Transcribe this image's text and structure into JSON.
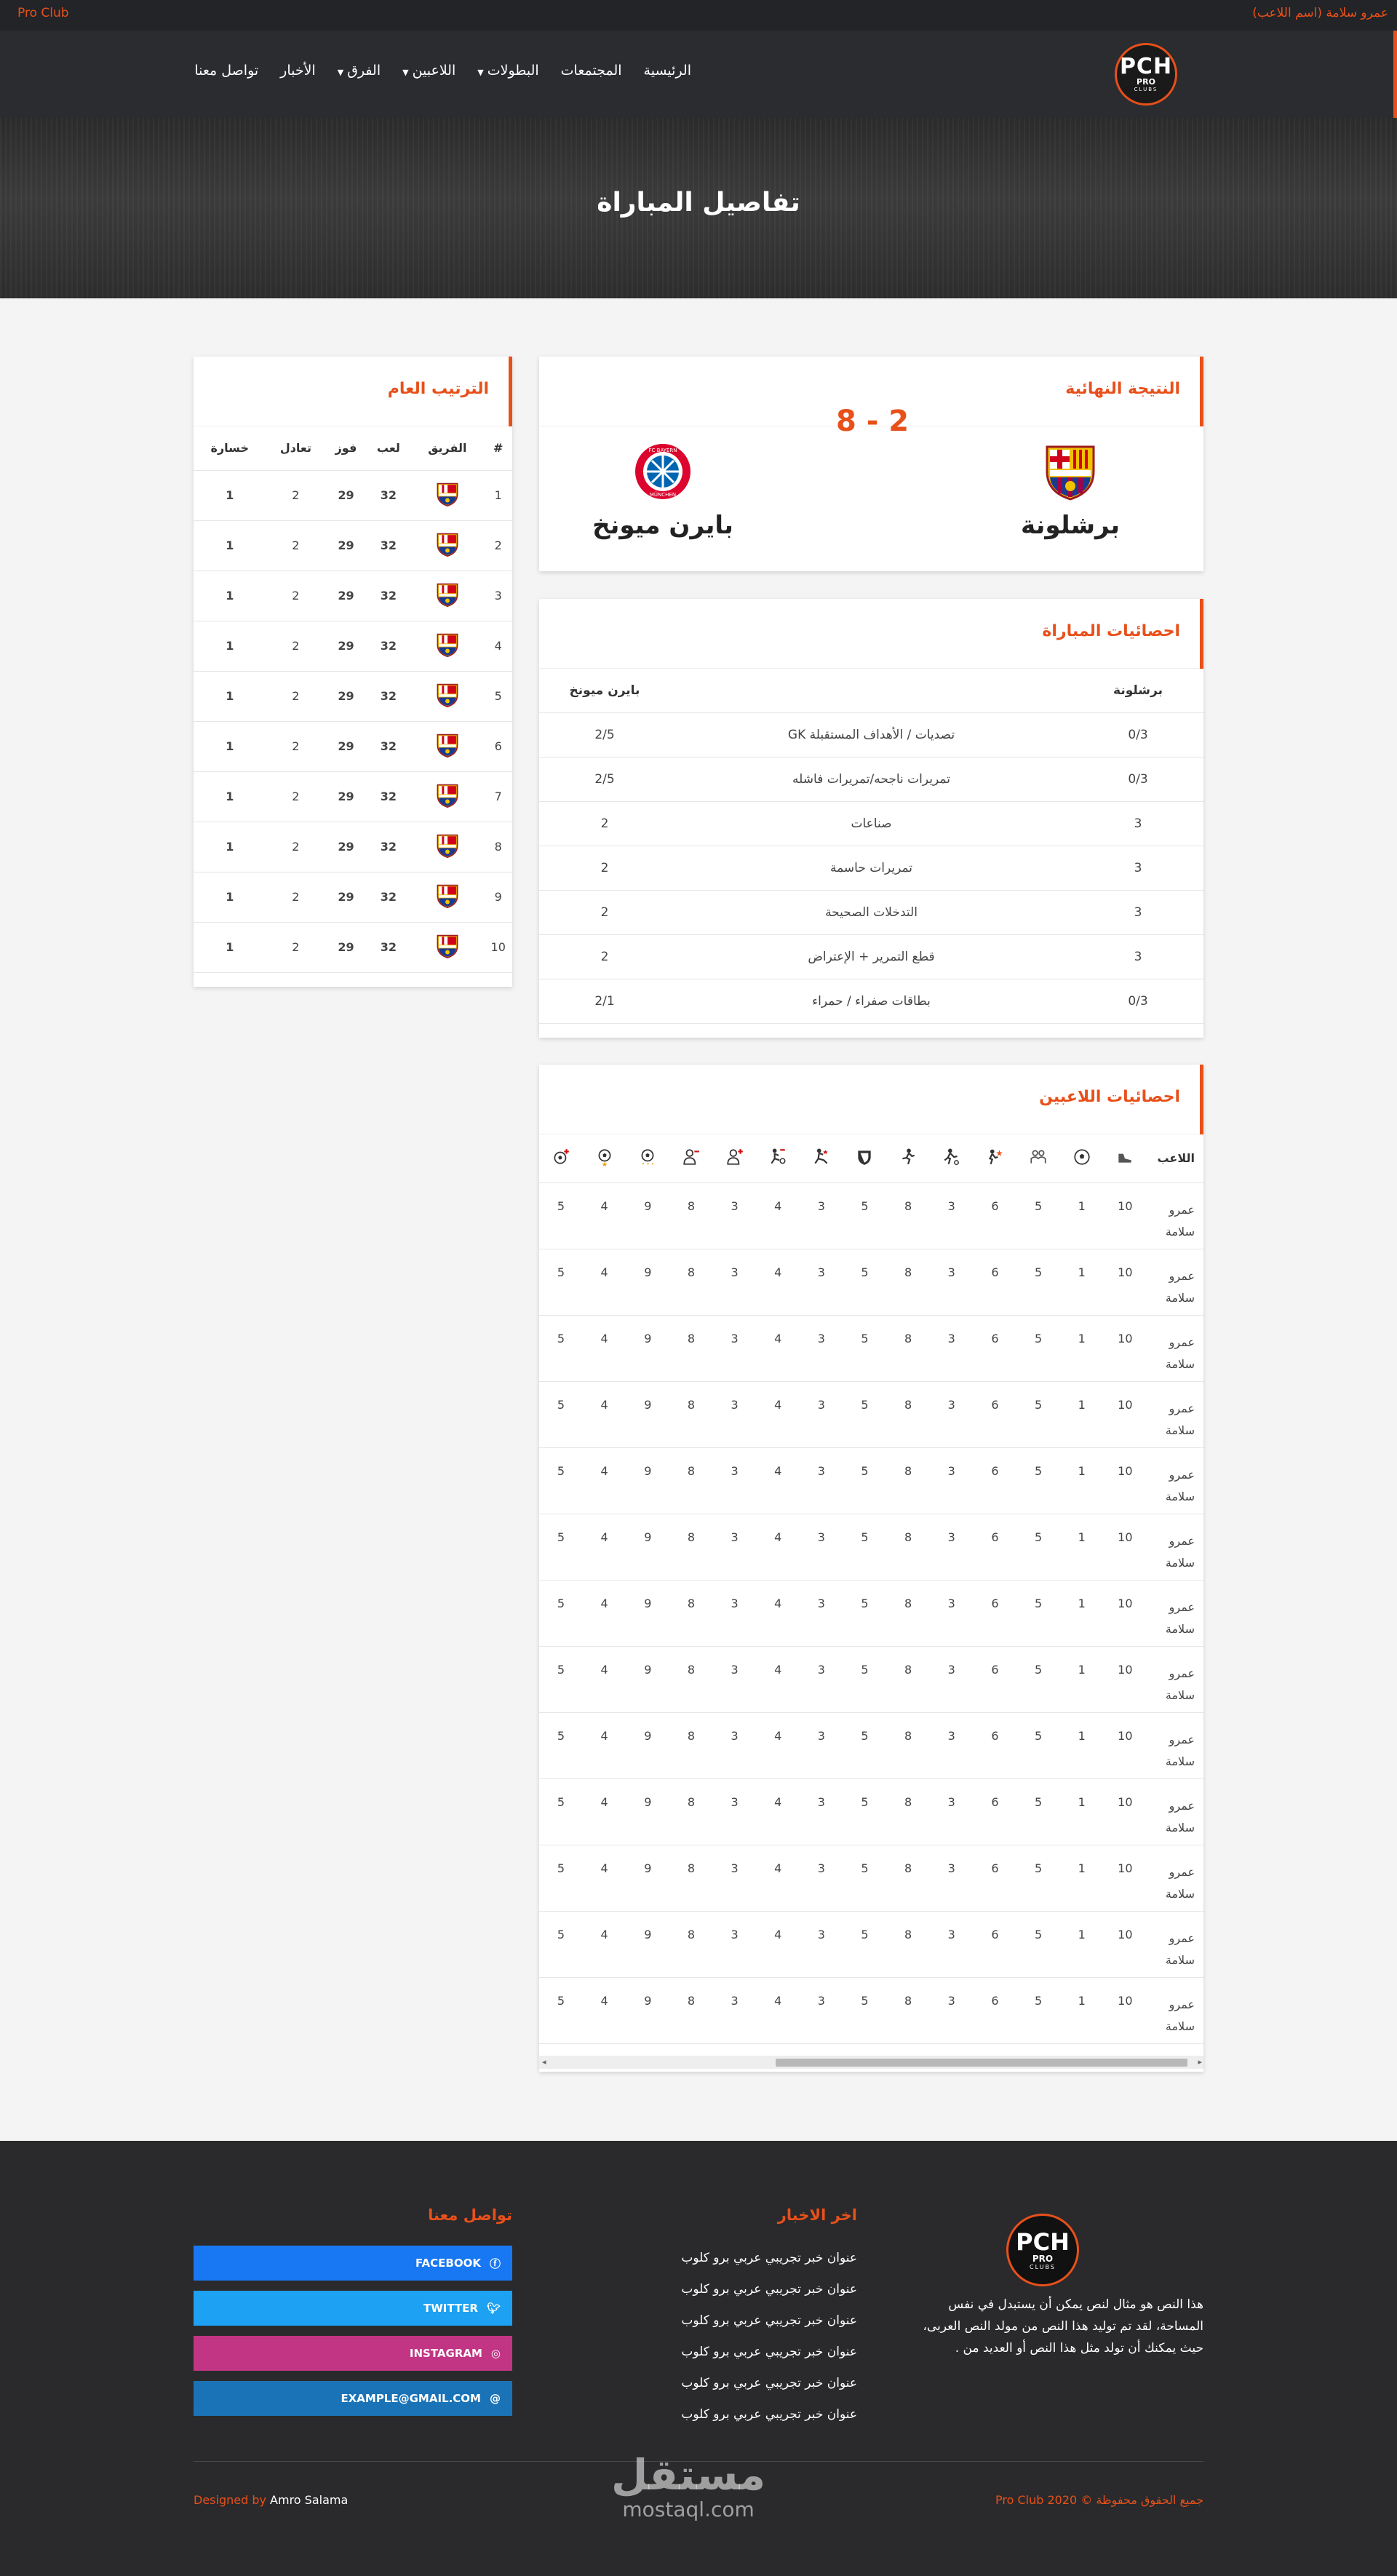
{
  "topbar": {
    "brand": "Pro Club",
    "user": "عمرو سلامة (اسم اللاعب)"
  },
  "logo": {
    "line1": "PCH",
    "line2": "PRO",
    "line3": "CLUBS"
  },
  "nav": [
    {
      "label": "الرئيسية",
      "dropdown": false
    },
    {
      "label": "المجتمعات",
      "dropdown": false
    },
    {
      "label": "البطولات",
      "dropdown": true
    },
    {
      "label": "اللاعبين",
      "dropdown": true
    },
    {
      "label": "الفرق",
      "dropdown": true
    },
    {
      "label": "الأخبار",
      "dropdown": false
    },
    {
      "label": "تواصل معنا",
      "dropdown": false
    }
  ],
  "hero": {
    "title": "تفاصيل المباراة"
  },
  "final": {
    "title": "النتيجة النهائية",
    "home": "برشلونة",
    "away": "بايرن ميونخ",
    "score": "8 - 2"
  },
  "stats": {
    "title": "احصائيات المباراة",
    "home": "برشلونة",
    "away": "بايرن ميونخ",
    "rows": [
      {
        "home": "0/3",
        "label": "GK تصديات / الأهداف المستقبلة",
        "away": "2/5"
      },
      {
        "home": "0/3",
        "label": "تمريرات ناجحه/تمريرات فاشله",
        "away": "2/5"
      },
      {
        "home": "3",
        "label": "صناعات",
        "away": "2"
      },
      {
        "home": "3",
        "label": "تمريرات حاسمة",
        "away": "2"
      },
      {
        "home": "3",
        "label": "التدخلات الصحيحة",
        "away": "2"
      },
      {
        "home": "3",
        "label": "قطع التمرير + الإعتراض",
        "away": "2"
      },
      {
        "home": "0/3",
        "label": "بطاقات صفراء / حمراء",
        "away": "2/1"
      }
    ]
  },
  "standings": {
    "title": "الترتيب العام",
    "headers": [
      "#",
      "الفريق",
      "لعب",
      "فوز",
      "تعادل",
      "خسارة"
    ],
    "rows": [
      {
        "rank": "1",
        "played": "32",
        "won": "29",
        "draw": "2",
        "lost": "1"
      },
      {
        "rank": "2",
        "played": "32",
        "won": "29",
        "draw": "2",
        "lost": "1"
      },
      {
        "rank": "3",
        "played": "32",
        "won": "29",
        "draw": "2",
        "lost": "1"
      },
      {
        "rank": "4",
        "played": "32",
        "won": "29",
        "draw": "2",
        "lost": "1"
      },
      {
        "rank": "5",
        "played": "32",
        "won": "29",
        "draw": "2",
        "lost": "1"
      },
      {
        "rank": "6",
        "played": "32",
        "won": "29",
        "draw": "2",
        "lost": "1"
      },
      {
        "rank": "7",
        "played": "32",
        "won": "29",
        "draw": "2",
        "lost": "1"
      },
      {
        "rank": "8",
        "played": "32",
        "won": "29",
        "draw": "2",
        "lost": "1"
      },
      {
        "rank": "9",
        "played": "32",
        "won": "29",
        "draw": "2",
        "lost": "1"
      },
      {
        "rank": "10",
        "played": "32",
        "won": "29",
        "draw": "2",
        "lost": "1"
      }
    ]
  },
  "players": {
    "title": "احصائيات اللاعبين",
    "player_header": "اللاعب",
    "icons": [
      "boot-icon",
      "ball-icon",
      "team-players-icon",
      "player-star-icon",
      "dribble-icon",
      "runner-icon",
      "shield-icon",
      "kick-icon",
      "goal-kick-icon",
      "player-plus-icon",
      "player-minus-icon",
      "ball-stars-icon",
      "ball-star-icon",
      "ball-plus-icon"
    ],
    "rows": [
      {
        "name": "عمرو سلامة",
        "values": [
          "10",
          "1",
          "5",
          "6",
          "3",
          "8",
          "5",
          "3",
          "4",
          "3",
          "8",
          "9",
          "4",
          "5"
        ]
      },
      {
        "name": "عمرو سلامة",
        "values": [
          "10",
          "1",
          "5",
          "6",
          "3",
          "8",
          "5",
          "3",
          "4",
          "3",
          "8",
          "9",
          "4",
          "5"
        ]
      },
      {
        "name": "عمرو سلامة",
        "values": [
          "10",
          "1",
          "5",
          "6",
          "3",
          "8",
          "5",
          "3",
          "4",
          "3",
          "8",
          "9",
          "4",
          "5"
        ]
      },
      {
        "name": "عمرو سلامة",
        "values": [
          "10",
          "1",
          "5",
          "6",
          "3",
          "8",
          "5",
          "3",
          "4",
          "3",
          "8",
          "9",
          "4",
          "5"
        ]
      },
      {
        "name": "عمرو سلامة",
        "values": [
          "10",
          "1",
          "5",
          "6",
          "3",
          "8",
          "5",
          "3",
          "4",
          "3",
          "8",
          "9",
          "4",
          "5"
        ]
      },
      {
        "name": "عمرو سلامة",
        "values": [
          "10",
          "1",
          "5",
          "6",
          "3",
          "8",
          "5",
          "3",
          "4",
          "3",
          "8",
          "9",
          "4",
          "5"
        ]
      },
      {
        "name": "عمرو سلامة",
        "values": [
          "10",
          "1",
          "5",
          "6",
          "3",
          "8",
          "5",
          "3",
          "4",
          "3",
          "8",
          "9",
          "4",
          "5"
        ]
      },
      {
        "name": "عمرو سلامة",
        "values": [
          "10",
          "1",
          "5",
          "6",
          "3",
          "8",
          "5",
          "3",
          "4",
          "3",
          "8",
          "9",
          "4",
          "5"
        ]
      },
      {
        "name": "عمرو سلامة",
        "values": [
          "10",
          "1",
          "5",
          "6",
          "3",
          "8",
          "5",
          "3",
          "4",
          "3",
          "8",
          "9",
          "4",
          "5"
        ]
      },
      {
        "name": "عمرو سلامة",
        "values": [
          "10",
          "1",
          "5",
          "6",
          "3",
          "8",
          "5",
          "3",
          "4",
          "3",
          "8",
          "9",
          "4",
          "5"
        ]
      },
      {
        "name": "عمرو سلامة",
        "values": [
          "10",
          "1",
          "5",
          "6",
          "3",
          "8",
          "5",
          "3",
          "4",
          "3",
          "8",
          "9",
          "4",
          "5"
        ]
      },
      {
        "name": "عمرو سلامة",
        "values": [
          "10",
          "1",
          "5",
          "6",
          "3",
          "8",
          "5",
          "3",
          "4",
          "3",
          "8",
          "9",
          "4",
          "5"
        ]
      },
      {
        "name": "عمرو سلامة",
        "values": [
          "10",
          "1",
          "5",
          "6",
          "3",
          "8",
          "5",
          "3",
          "4",
          "3",
          "8",
          "9",
          "4",
          "5"
        ]
      }
    ]
  },
  "footer": {
    "about": "هذا النص هو مثال لنص يمكن أن يستبدل في نفس المساحة، لقد تم توليد هذا النص من مولد النص العربى، حيث يمكنك أن تولد مثل هذا النص أو العديد من .",
    "news_title": "اخر الاخبار",
    "news": [
      "عنوان خبر تجريبي عربي برو كلوب",
      "عنوان خبر تجريبي عربي برو كلوب",
      "عنوان خبر تجريبي عربي برو كلوب",
      "عنوان خبر تجريبي عربي برو كلوب",
      "عنوان خبر تجريبي عربي برو كلوب",
      "عنوان خبر تجريبي عربي برو كلوب"
    ],
    "contact_title": "تواصل معنا",
    "social": {
      "facebook": "FACEBOOK",
      "twitter": "TWITTER",
      "instagram": "INSTAGRAM",
      "email": "EXAMPLE@GMAIL.COM"
    },
    "copyright": "جميع الحقوق محفوظة © Pro Club 2020",
    "designed_by": "Designed by",
    "designer": "Amro Salama",
    "watermark": {
      "arabic": "مستقل",
      "latin": "mostaql.com"
    }
  },
  "colors": {
    "accent": "#e8501a",
    "dark": "#2a2c30",
    "facebook": "#1877f2",
    "twitter": "#1da1f2",
    "instagram": "#c13584",
    "email": "#1a73b7"
  }
}
